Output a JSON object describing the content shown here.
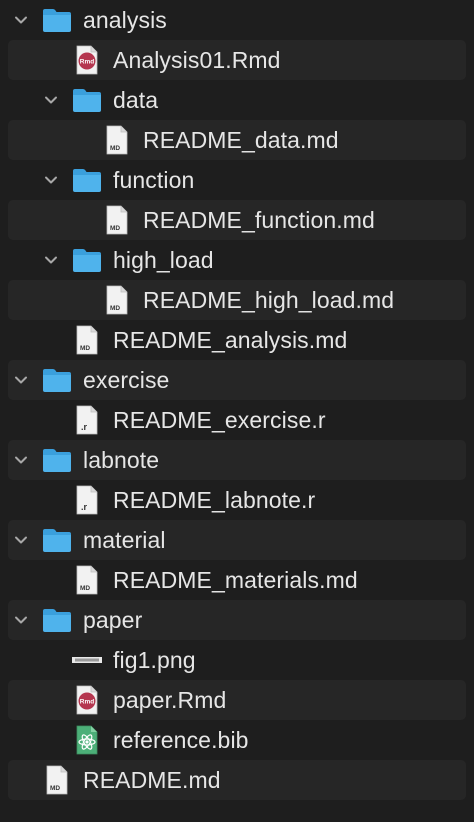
{
  "tree": [
    {
      "depth": 0,
      "kind": "folder",
      "expanded": true,
      "label": "analysis",
      "icon": "folder-icon"
    },
    {
      "depth": 1,
      "kind": "file",
      "label": "Analysis01.Rmd",
      "icon": "rmd-file-icon"
    },
    {
      "depth": 1,
      "kind": "folder",
      "expanded": true,
      "label": "data",
      "icon": "folder-icon"
    },
    {
      "depth": 2,
      "kind": "file",
      "label": "README_data.md",
      "icon": "md-file-icon"
    },
    {
      "depth": 1,
      "kind": "folder",
      "expanded": true,
      "label": "function",
      "icon": "folder-icon"
    },
    {
      "depth": 2,
      "kind": "file",
      "label": "README_function.md",
      "icon": "md-file-icon"
    },
    {
      "depth": 1,
      "kind": "folder",
      "expanded": true,
      "label": "high_load",
      "icon": "folder-icon"
    },
    {
      "depth": 2,
      "kind": "file",
      "label": "README_high_load.md",
      "icon": "md-file-icon"
    },
    {
      "depth": 1,
      "kind": "file",
      "label": "README_analysis.md",
      "icon": "md-file-icon"
    },
    {
      "depth": 0,
      "kind": "folder",
      "expanded": true,
      "label": "exercise",
      "icon": "folder-icon"
    },
    {
      "depth": 1,
      "kind": "file",
      "label": "README_exercise.r",
      "icon": "r-file-icon"
    },
    {
      "depth": 0,
      "kind": "folder",
      "expanded": true,
      "label": "labnote",
      "icon": "folder-icon"
    },
    {
      "depth": 1,
      "kind": "file",
      "label": "README_labnote.r",
      "icon": "r-file-icon"
    },
    {
      "depth": 0,
      "kind": "folder",
      "expanded": true,
      "label": "material",
      "icon": "folder-icon"
    },
    {
      "depth": 1,
      "kind": "file",
      "label": "README_materials.md",
      "icon": "md-file-icon"
    },
    {
      "depth": 0,
      "kind": "folder",
      "expanded": true,
      "label": "paper",
      "icon": "folder-icon"
    },
    {
      "depth": 1,
      "kind": "file",
      "label": "fig1.png",
      "icon": "png-file-icon"
    },
    {
      "depth": 1,
      "kind": "file",
      "label": "paper.Rmd",
      "icon": "rmd-file-icon"
    },
    {
      "depth": 1,
      "kind": "file",
      "label": "reference.bib",
      "icon": "bib-file-icon"
    },
    {
      "depth": 0,
      "kind": "file",
      "label": "README.md",
      "icon": "md-file-icon"
    }
  ],
  "icon_text": {
    "md": "MD",
    "r": ".r",
    "rmd": "Rmd"
  },
  "colors": {
    "background": "#1e1e1e",
    "alt_row": "#262626",
    "text": "#e6e6e6",
    "folder_front": "#4fb3ec",
    "folder_back": "#3a9fdc",
    "chevron": "#a8a8a8",
    "doc": "#f2f2f2",
    "rmd_badge": "#b5364f",
    "bib_badge": "#4caf78"
  }
}
